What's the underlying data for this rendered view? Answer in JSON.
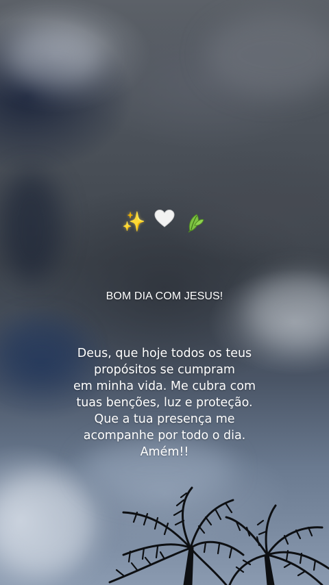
{
  "background": {
    "description_colors": {
      "sky_dark": "#3f454d",
      "sky_blue": "#4a5566",
      "cloud_light": "#d7dce4",
      "palm_silhouette": "#0d0f12"
    }
  },
  "emojis": [
    {
      "icon": "sparkles-icon",
      "glyph": "✨"
    },
    {
      "icon": "white-heart-icon",
      "glyph": "🤍"
    },
    {
      "icon": "leaf-icon",
      "glyph": "🍃"
    }
  ],
  "title": "BOM DIA COM JESUS!",
  "prayer": {
    "lines": [
      "Deus, que hoje todos os teus",
      "propósitos se cumpram",
      "em minha vida. Me cubra com",
      "tuas benções, luz e proteção.",
      "Que a tua presença me",
      "acompanhe por todo o dia.",
      "Amém!!"
    ]
  }
}
